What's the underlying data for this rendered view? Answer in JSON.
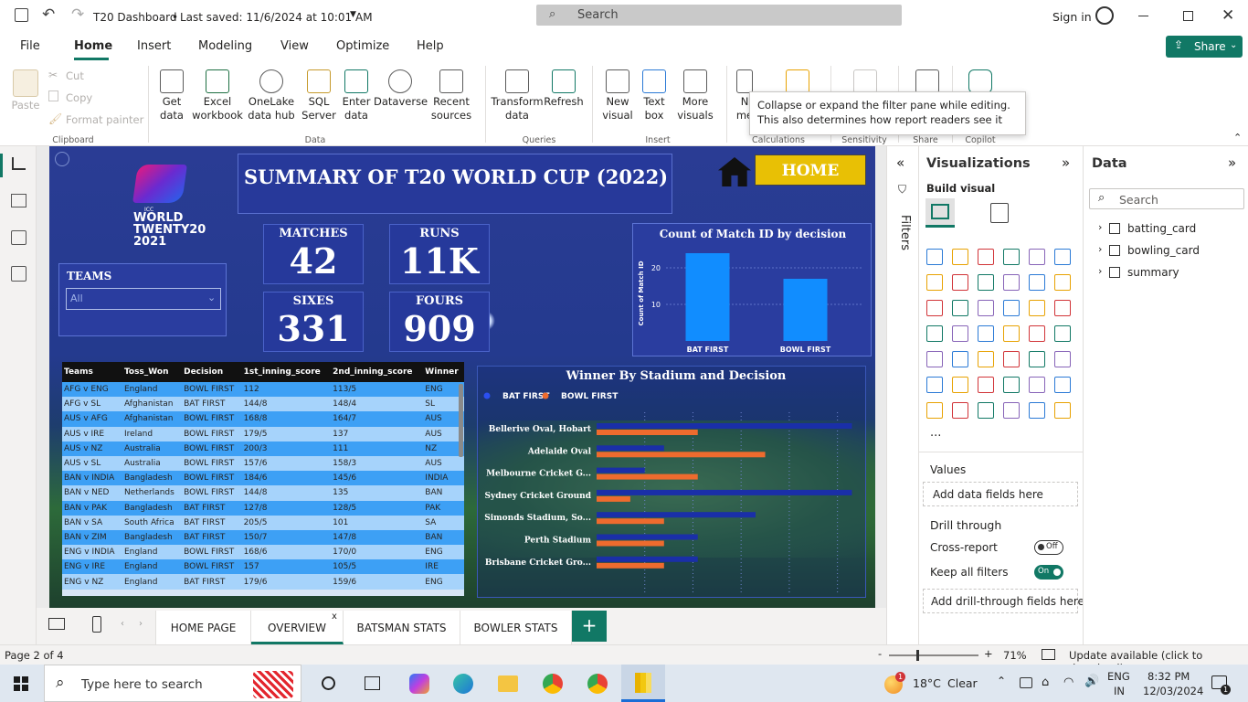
{
  "titlebar": {
    "app_title": "T20 Dashboard",
    "saved": "Last saved: 11/6/2024 at 10:01 AM",
    "search_placeholder": "Search",
    "sign_in": "Sign in"
  },
  "menu": {
    "tabs": [
      "File",
      "Home",
      "Insert",
      "Modeling",
      "View",
      "Optimize",
      "Help"
    ],
    "active": "Home",
    "share": "Share"
  },
  "ribbon": {
    "clipboard": {
      "paste": "Paste",
      "cut": "Cut",
      "copy": "Copy",
      "format_painter": "Format painter",
      "group": "Clipboard"
    },
    "data": {
      "items": [
        "Get data",
        "Excel workbook",
        "OneLake data hub",
        "SQL Server",
        "Enter data",
        "Dataverse",
        "Recent sources"
      ],
      "group": "Data"
    },
    "queries": {
      "items": [
        "Transform data",
        "Refresh"
      ],
      "group": "Queries"
    },
    "insert": {
      "items": [
        "New visual",
        "Text box",
        "More visuals"
      ],
      "group": "Insert"
    },
    "calc_group": "Calculations",
    "sensitivity_group": "Sensitivity",
    "share_group": "Share",
    "copilot_group": "Copilot",
    "partial_label": "N me"
  },
  "tooltip": "Collapse or expand the filter pane while editing. This also determines how report readers see it",
  "report": {
    "title": "SUMMARY OF T20 WORLD CUP (2022)",
    "home_button": "HOME",
    "logo_text": "WORLD TWENTY20 2021",
    "logo_small": "ICC",
    "teams_label": "TEAMS",
    "teams_value": "All",
    "kpis": [
      {
        "label": "MATCHES",
        "value": "42"
      },
      {
        "label": "RUNS",
        "value": "11K"
      },
      {
        "label": "SIXES",
        "value": "331"
      },
      {
        "label": "FOURS",
        "value": "909"
      }
    ]
  },
  "table": {
    "columns": [
      "Teams",
      "Toss_Won",
      "Decision",
      "1st_inning_score",
      "2nd_inning_score",
      "Winner"
    ],
    "rows": [
      [
        "AFG v ENG",
        "England",
        "BOWL FIRST",
        "112",
        "113/5",
        "ENG"
      ],
      [
        "AFG v SL",
        "Afghanistan",
        "BAT FIRST",
        "144/8",
        "148/4",
        "SL"
      ],
      [
        "AUS v AFG",
        "Afghanistan",
        "BOWL FIRST",
        "168/8",
        "164/7",
        "AUS"
      ],
      [
        "AUS v IRE",
        "Ireland",
        "BOWL FIRST",
        "179/5",
        "137",
        "AUS"
      ],
      [
        "AUS v NZ",
        "Australia",
        "BOWL FIRST",
        "200/3",
        "111",
        "NZ"
      ],
      [
        "AUS v SL",
        "Australia",
        "BOWL FIRST",
        "157/6",
        "158/3",
        "AUS"
      ],
      [
        "BAN v INDIA",
        "Bangladesh",
        "BOWL FIRST",
        "184/6",
        "145/6",
        "INDIA"
      ],
      [
        "BAN v NED",
        "Netherlands",
        "BOWL FIRST",
        "144/8",
        "135",
        "BAN"
      ],
      [
        "BAN v PAK",
        "Bangladesh",
        "BAT FIRST",
        "127/8",
        "128/5",
        "PAK"
      ],
      [
        "BAN v SA",
        "South Africa",
        "BAT FIRST",
        "205/5",
        "101",
        "SA"
      ],
      [
        "BAN v ZIM",
        "Bangladesh",
        "BAT FIRST",
        "150/7",
        "147/8",
        "BAN"
      ],
      [
        "ENG v INDIA",
        "England",
        "BOWL FIRST",
        "168/6",
        "170/0",
        "ENG"
      ],
      [
        "ENG v IRE",
        "England",
        "BOWL FIRST",
        "157",
        "105/5",
        "IRE"
      ],
      [
        "ENG v NZ",
        "England",
        "BAT FIRST",
        "179/6",
        "159/6",
        "ENG"
      ]
    ]
  },
  "chart_data": [
    {
      "type": "bar",
      "title": "Count of Match ID by decision",
      "ylabel": "Count of Match ID",
      "categories": [
        "BAT FIRST",
        "BOWL FIRST"
      ],
      "values": [
        24,
        17
      ],
      "yticks": [
        10,
        20
      ],
      "ylim": [
        0,
        26
      ],
      "color": "#118dff"
    },
    {
      "type": "bar",
      "title": "Winner By Stadium and Decision",
      "orientation": "horizontal",
      "legend_position": "top-left",
      "categories": [
        "Bellerive Oval, Hobart",
        "Adelaide Oval",
        "Melbourne Cricket G...",
        "Sydney Cricket Ground",
        "Simonds Stadium, So...",
        "Perth Stadium",
        "Brisbane Cricket Gro..."
      ],
      "series": [
        {
          "name": "BAT FIRST",
          "color": "#1a2fa8",
          "values": [
            5.3,
            1.4,
            1.0,
            5.3,
            3.3,
            2.1,
            2.1
          ]
        },
        {
          "name": "BOWL FIRST",
          "color": "#ee6b2e",
          "values": [
            2.1,
            3.5,
            2.1,
            0.7,
            1.4,
            1.4,
            1.4
          ]
        }
      ]
    }
  ],
  "filters_label": "Filters",
  "visualizations": {
    "title": "Visualizations",
    "build_visual": "Build visual",
    "values": "Values",
    "add_data_fields": "Add data fields here",
    "drill_through": "Drill through",
    "cross_report": "Cross-report",
    "cross_report_state": "Off",
    "keep_all_filters": "Keep all filters",
    "keep_filters_state": "On",
    "add_drill": "Add drill-through fields here",
    "more": "..."
  },
  "data_pane": {
    "title": "Data",
    "search_placeholder": "Search",
    "tables": [
      "batting_card",
      "bowling_card",
      "summary"
    ]
  },
  "page_tabs": {
    "tabs": [
      "HOME PAGE",
      "OVERVIEW",
      "BATSMAN STATS",
      "BOWLER STATS"
    ],
    "active": "OVERVIEW"
  },
  "status": {
    "page": "Page 2 of 4",
    "zoom": "71%",
    "update": "Update available (click to download)"
  },
  "taskbar": {
    "search_placeholder": "Type here to search",
    "weather_temp": "18°C",
    "weather_text": "Clear",
    "weather_badge": "1",
    "lang": "ENG",
    "region": "IN",
    "time": "8:32 PM",
    "date": "12/03/2024",
    "notifications": "1"
  }
}
